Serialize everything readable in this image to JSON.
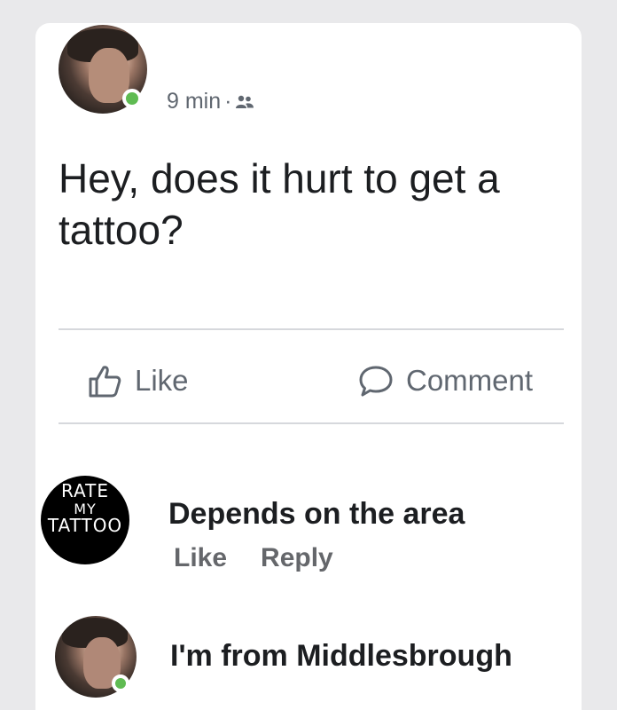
{
  "post": {
    "time": "9 min",
    "separator": "·",
    "audience_icon": "friends-icon",
    "text_line1": "Hey, does it hurt to get a",
    "text_line2": "tattoo?",
    "online_color": "#5fbb52"
  },
  "actions": {
    "like_label": "Like",
    "like_icon": "thumbs-up-icon",
    "comment_label": "Comment",
    "comment_icon": "speech-bubble-icon"
  },
  "comments": [
    {
      "avatar_line1": "RATE",
      "avatar_line2": "MY",
      "avatar_line3": "TATTOO",
      "text": "Depends on the area",
      "like_label": "Like",
      "reply_label": "Reply"
    },
    {
      "text": "I'm from Middlesbrough"
    }
  ]
}
